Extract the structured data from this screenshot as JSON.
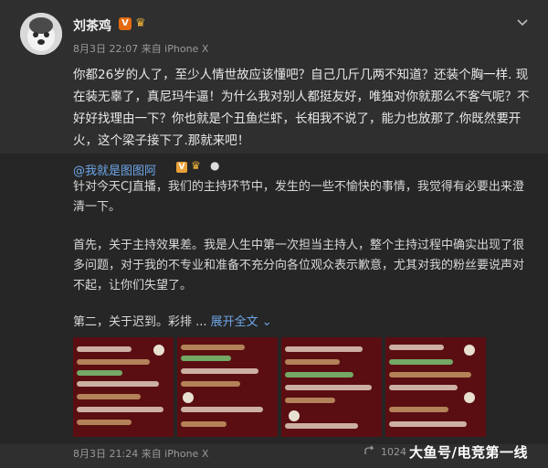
{
  "post": {
    "author": "刘茶鸡",
    "meta": "8月3日 22:07 来自 iPhone X",
    "text": "你都26岁的人了，至少人情世故应该懂吧？自己几斤几两不知道？还装个胸一样. 现在装无辜了，真尼玛牛逼！为什么我对别人都挺友好，唯独对你就那么不客气呢？不好好找理由一下？你也就是个丑鱼烂虾，长相我不说了，能力也放那了.你既然要开火，这个梁子接下了.那就来吧！"
  },
  "quoted": {
    "author": "@我就是图图阿",
    "p1": "针对今天CJ直播，我们的主持环节中，发生的一些不愉快的事情，我觉得有必要出来澄清一下。",
    "p2": "首先，关于主持效果差。我是人生中第一次担当主持人，整个主持过程中确实出现了很多问题，对于我的不专业和准备不充分向各位观众表示歉意，尤其对我的粉丝要说声对不起，让你们失望了。",
    "p3_prefix": "第二，关于迟到。彩排 ... ",
    "expand_label": "展开全文 ⌄",
    "footer_time": "8月3日 21:24 来自 iPhone X",
    "share_count": "1024"
  },
  "watermark": "大鱼号/电竞第一线",
  "icons": {
    "avatar": "dog-avatar",
    "chevron": "chevron-down-icon",
    "share": "share-icon"
  },
  "colors": {
    "link": "#6ea6e8",
    "verified": "#e46a10",
    "thumb_bg": "#5a0e12"
  }
}
